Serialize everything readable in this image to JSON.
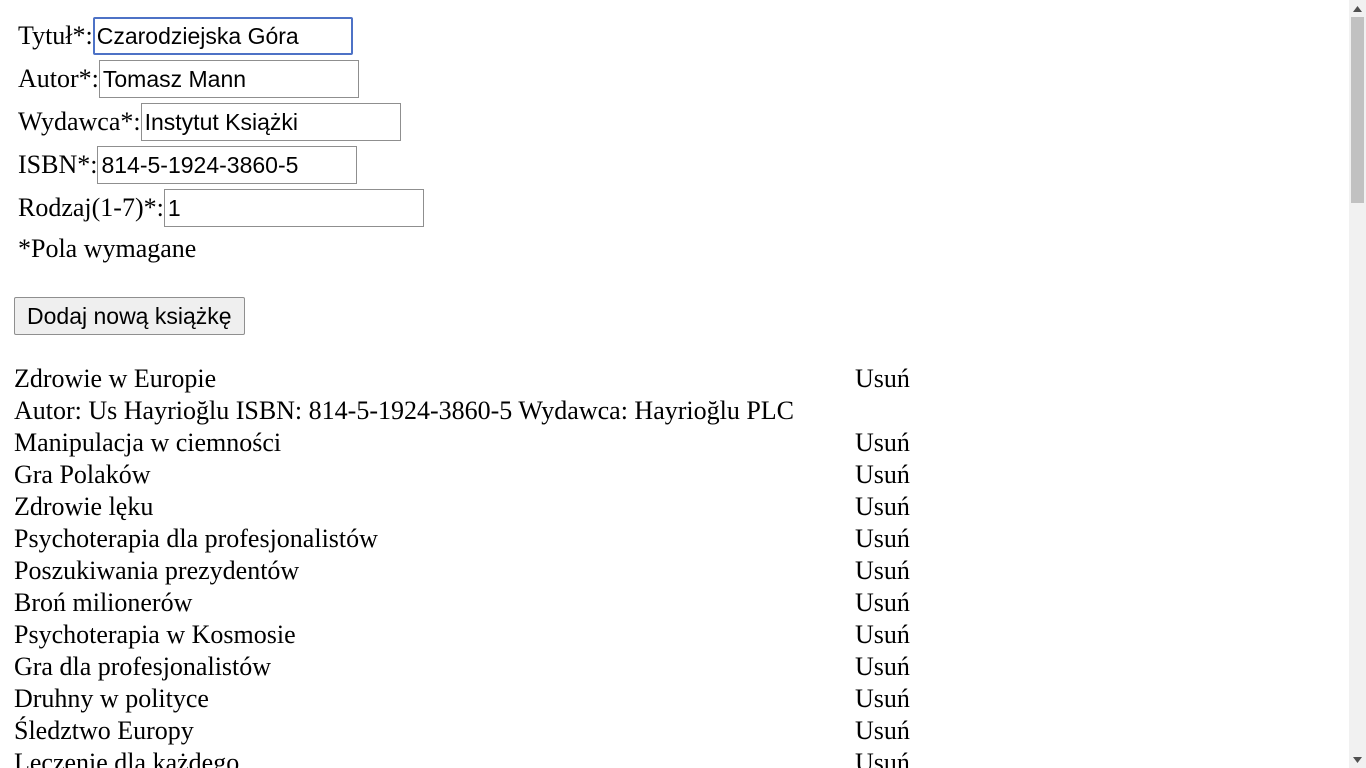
{
  "form": {
    "title_label": "Tytuł*:",
    "title_value": "Czarodziejska Góra",
    "author_label": "Autor*:",
    "author_value": "Tomasz Mann",
    "publisher_label": "Wydawca*:",
    "publisher_value": "Instytut Książki",
    "isbn_label": "ISBN*:",
    "isbn_value": "814-5-1924-3860-5",
    "genre_label": "Rodzaj(1-7)*:",
    "genre_value": "1",
    "required_note": "*Pola wymagane",
    "add_button": "Dodaj nową książkę"
  },
  "books": {
    "remove_label": "Usuń",
    "expanded_details": "Autor: Us Hayrioğlu ISBN: 814-5-1924-3860-5 Wydawca: Hayrioğlu PLC",
    "items": [
      "Zdrowie w Europie",
      "Manipulacja w ciemności",
      "Gra Polaków",
      "Zdrowie lęku",
      "Psychoterapia dla profesjonalistów",
      "Poszukiwania prezydentów",
      "Broń milionerów",
      "Psychoterapia w Kosmosie",
      "Gra dla profesjonalistów",
      "Druhny w polityce",
      "Śledztwo Europy",
      "Leczenie dla każdego"
    ]
  },
  "icons": {
    "scroll_up": "scroll-up-arrow-icon",
    "scroll_down": "scroll-down-arrow-icon"
  }
}
